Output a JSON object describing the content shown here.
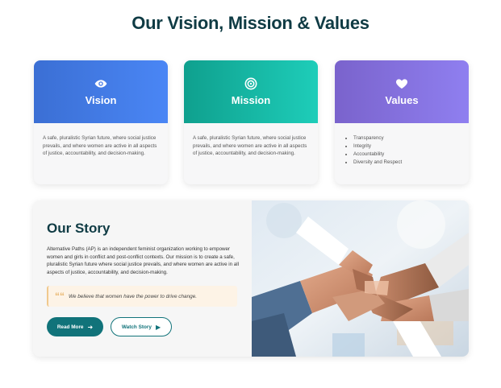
{
  "page": {
    "title": "Our Vision, Mission & Values"
  },
  "cards": [
    {
      "title": "Vision",
      "icon": "eye-icon",
      "text": "A safe, pluralistic Syrian future, where social justice prevails, and where women are active in all aspects of justice, accountability, and decision-making."
    },
    {
      "title": "Mission",
      "icon": "target-icon",
      "text": "A safe, pluralistic Syrian future, where social justice prevails, and where women are active in all aspects of justice, accountability, and decision-making."
    },
    {
      "title": "Values",
      "icon": "heart-icon",
      "items": [
        "Transparency",
        "Integrity",
        "Accountability",
        "Diversity and Respect"
      ]
    }
  ],
  "story": {
    "title": "Our Story",
    "text": "Alternative Paths (AP) is an independent feminist organization working to empower women and girls in conflict and post-conflict contexts. Our mission is to create a safe, pluralistic Syrian future where social justice prevails, and where women are active in all aspects of justice, accountability, and decision-making.",
    "quote": "We believe that women have the power to drive change.",
    "read_more_label": "Read More",
    "watch_story_label": "Watch Story",
    "image_icon": "hands-together-photo"
  },
  "colors": {
    "title": "#0f3b44",
    "vision": "#3b6fd4",
    "mission": "#0fa08e",
    "values": "#7a63cc",
    "accent": "#11737a"
  }
}
